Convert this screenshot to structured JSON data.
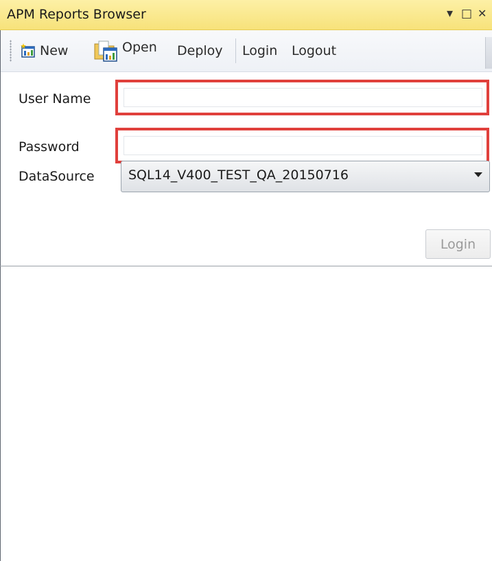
{
  "window": {
    "title": "APM Reports Browser",
    "controls": {
      "dropdown": "▾",
      "maximize": "□",
      "close": "✕"
    }
  },
  "toolbar": {
    "new_label": "New",
    "open_label": "Open",
    "deploy_label": "Deploy",
    "login_label": "Login",
    "logout_label": "Logout",
    "new_icon": "new-report-icon",
    "open_icon": "open-report-icon"
  },
  "form": {
    "username_label": "User Name",
    "username_value": "",
    "password_label": "Password",
    "password_value": "",
    "datasource_label": "DataSource",
    "datasource_value": "SQL14_V400_TEST_QA_20150716",
    "login_button": "Login"
  },
  "colors": {
    "title_bar": "#f7e27a",
    "highlight": "#e0403c"
  }
}
